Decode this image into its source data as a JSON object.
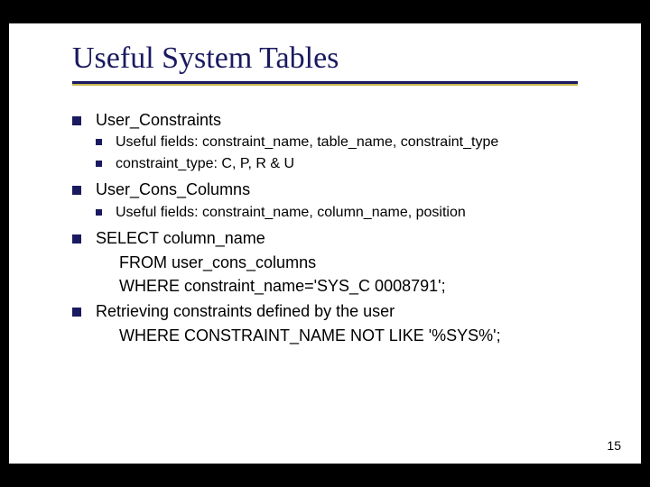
{
  "title": "Useful System Tables",
  "items": [
    {
      "label": "User_Constraints",
      "sub": [
        "Useful fields: constraint_name, table_name, constraint_type",
        "constraint_type: C, P, R & U"
      ]
    },
    {
      "label": "User_Cons_Columns",
      "sub": [
        "Useful fields: constraint_name, column_name, position"
      ]
    },
    {
      "label": "SELECT column_name",
      "cont": [
        "FROM user_cons_columns",
        "WHERE constraint_name='SYS_C 0008791';"
      ]
    },
    {
      "label": "Retrieving constraints defined by the user",
      "cont": [
        "WHERE CONSTRAINT_NAME NOT LIKE '%SYS%';"
      ]
    }
  ],
  "page_number": "15"
}
